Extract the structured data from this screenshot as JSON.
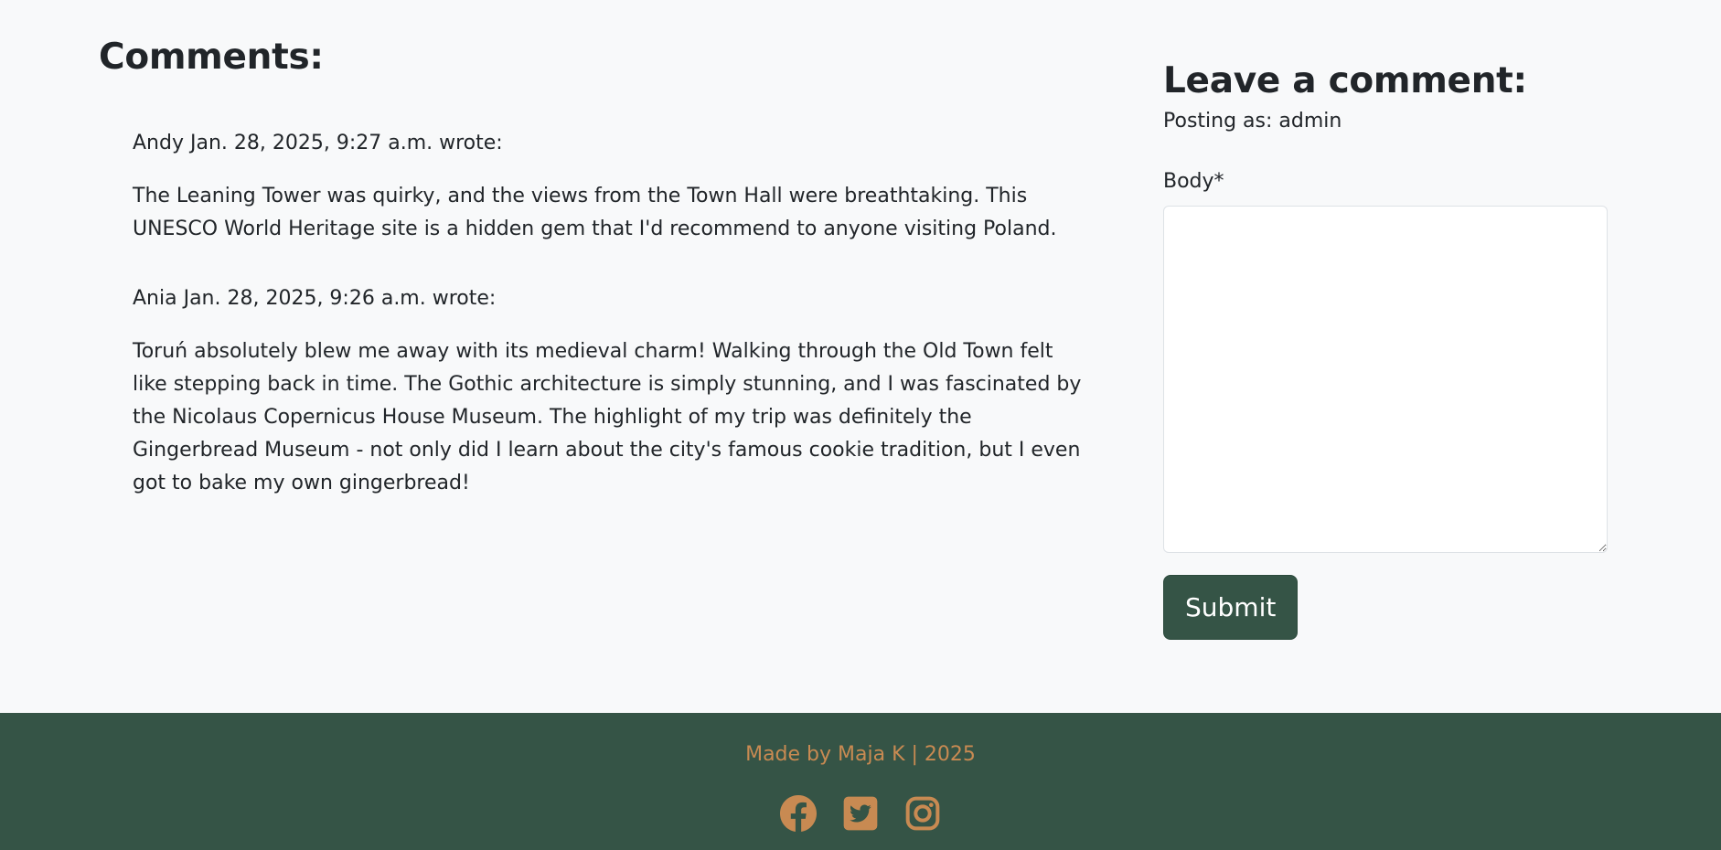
{
  "comments_section": {
    "title": "Comments:",
    "items": [
      {
        "meta": "Andy Jan. 28, 2025, 9:27 a.m. wrote:",
        "body": "The Leaning Tower was quirky, and the views from the Town Hall were breathtaking. This UNESCO World Heritage site is a hidden gem that I'd recommend to anyone visiting Poland."
      },
      {
        "meta": "Ania Jan. 28, 2025, 9:26 a.m. wrote:",
        "body": "Toruń absolutely blew me away with its medieval charm! Walking through the Old Town felt like stepping back in time. The Gothic architecture is simply stunning, and I was fascinated by the Nicolaus Copernicus House Museum. The highlight of my trip was definitely the Gingerbread Museum - not only did I learn about the city's famous cookie tradition, but I even got to bake my own gingerbread!"
      }
    ]
  },
  "comment_form": {
    "title": "Leave a comment:",
    "posting_as": "Posting as: admin",
    "body_label": "Body*",
    "body_value": "",
    "submit_label": "Submit"
  },
  "footer": {
    "text": "Made by Maja K | 2025",
    "social_icons": [
      "facebook-icon",
      "twitter-icon",
      "instagram-icon"
    ]
  },
  "colors": {
    "page_background": "#f8f9fa",
    "brand_green": "#355446",
    "accent_copper": "#c88a52",
    "text": "#212529"
  }
}
